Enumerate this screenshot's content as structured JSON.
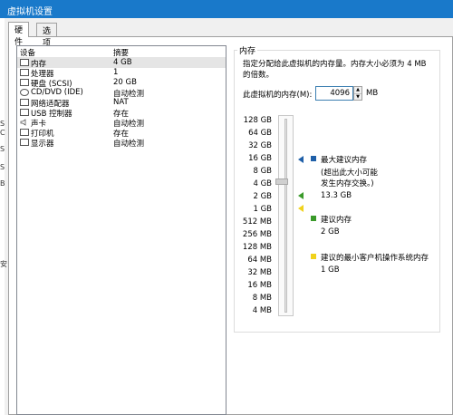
{
  "window": {
    "title": "虚拟机设置"
  },
  "background_fragments": [
    "S",
    "C",
    "S",
    "S",
    "B",
    "安"
  ],
  "tabs": [
    {
      "label": "硬件",
      "active": true
    },
    {
      "label": "选项",
      "active": false
    }
  ],
  "device_list": {
    "headers": {
      "device": "设备",
      "summary": "摘要"
    },
    "rows": [
      {
        "name": "内存",
        "summary": "4 GB",
        "icon": "memory-icon",
        "selected": true
      },
      {
        "name": "处理器",
        "summary": "1",
        "icon": "processor-icon"
      },
      {
        "name": "硬盘 (SCSI)",
        "summary": "20 GB",
        "icon": "harddisk-icon"
      },
      {
        "name": "CD/DVD (IDE)",
        "summary": "自动检测",
        "icon": "cdrom-icon"
      },
      {
        "name": "网络适配器",
        "summary": "NAT",
        "icon": "network-icon"
      },
      {
        "name": "USB 控制器",
        "summary": "存在",
        "icon": "usb-icon"
      },
      {
        "name": "声卡",
        "summary": "自动检测",
        "icon": "speaker-icon"
      },
      {
        "name": "打印机",
        "summary": "存在",
        "icon": "printer-icon"
      },
      {
        "name": "显示器",
        "summary": "自动检测",
        "icon": "monitor-icon"
      }
    ]
  },
  "memory": {
    "group_title": "内存",
    "description": "指定分配给此虚拟机的内存量。内存大小必须为 4 MB 的倍数。",
    "field_label": "此虚拟机的内存(M):",
    "value": "4096",
    "unit": "MB",
    "scale": [
      "128 GB",
      "64 GB",
      "32 GB",
      "16 GB",
      "8 GB",
      "4 GB",
      "2 GB",
      "1 GB",
      "512 MB",
      "256 MB",
      "128 MB",
      "64 MB",
      "32 MB",
      "16 MB",
      "8 MB",
      "4 MB"
    ],
    "legend": {
      "max": {
        "title": "最大建议内存",
        "note_line1": "(超出此大小可能",
        "note_line2": "发生内存交换。)",
        "value": "13.3 GB",
        "color": "#1f5fa8"
      },
      "recommended": {
        "title": "建议内存",
        "value": "2 GB",
        "color": "#3a9a2a"
      },
      "min": {
        "title": "建议的最小客户机操作系统内存",
        "value": "1 GB",
        "color": "#f0d21c"
      }
    }
  }
}
